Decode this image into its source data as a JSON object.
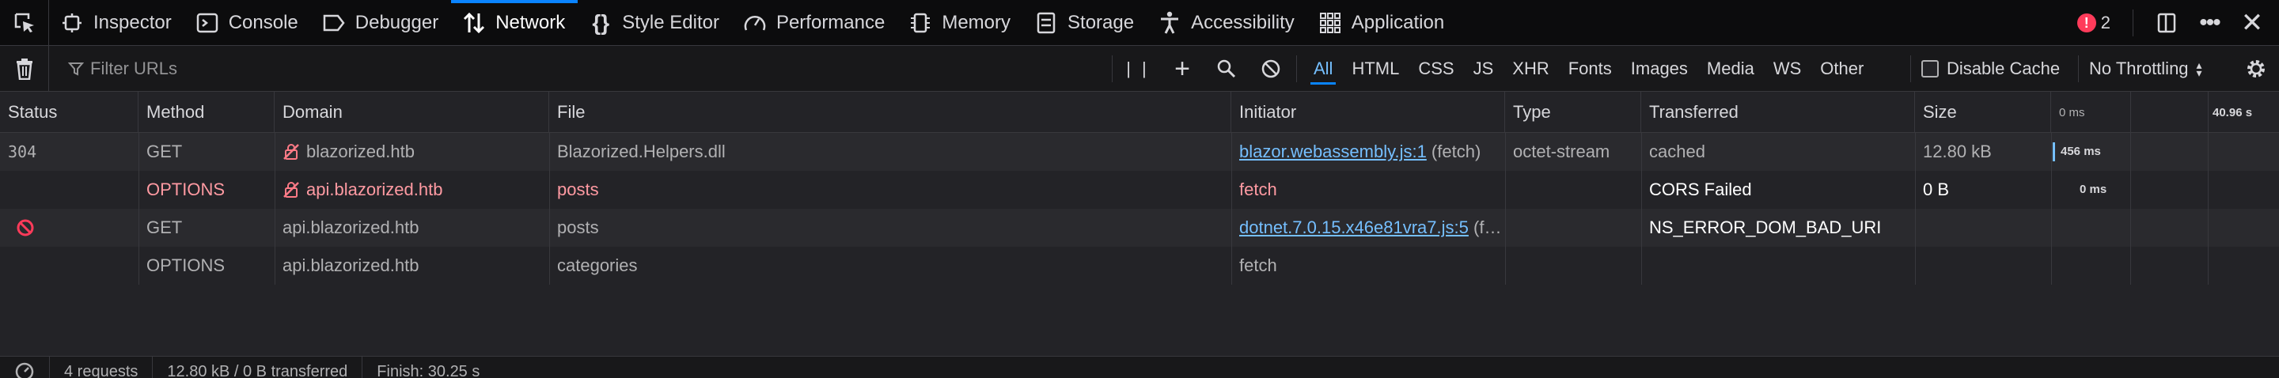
{
  "toolbox": {
    "tabs": [
      {
        "label": "Inspector",
        "icon": "inspector-icon"
      },
      {
        "label": "Console",
        "icon": "console-icon"
      },
      {
        "label": "Debugger",
        "icon": "debugger-icon"
      },
      {
        "label": "Network",
        "icon": "network-icon",
        "selected": true
      },
      {
        "label": "Style Editor",
        "icon": "style-editor-icon"
      },
      {
        "label": "Performance",
        "icon": "performance-icon"
      },
      {
        "label": "Memory",
        "icon": "memory-icon"
      },
      {
        "label": "Storage",
        "icon": "storage-icon"
      },
      {
        "label": "Accessibility",
        "icon": "accessibility-icon"
      },
      {
        "label": "Application",
        "icon": "application-icon"
      }
    ],
    "error_count": "2",
    "accent_color": "#0a84ff",
    "error_color": "#ff3b5a"
  },
  "toolbar": {
    "filter_placeholder": "Filter URLs",
    "type_filters": [
      "All",
      "HTML",
      "CSS",
      "JS",
      "XHR",
      "Fonts",
      "Images",
      "Media",
      "WS",
      "Other"
    ],
    "active_filter": "All",
    "disable_cache_label": "Disable Cache",
    "disable_cache_checked": false,
    "throttling": "No Throttling"
  },
  "table": {
    "columns": [
      "Status",
      "Method",
      "Domain",
      "File",
      "Initiator",
      "Type",
      "Transferred",
      "Size"
    ],
    "timeline_ticks": [
      "0 ms",
      "40.96 s"
    ],
    "rows": [
      {
        "status": "304",
        "method": "GET",
        "domain": "blazorized.htb",
        "domain_insecure": true,
        "file": "Blazorized.Helpers.dll",
        "initiator_link": "blazor.webassembly.js:1",
        "initiator_extra": " (fetch)",
        "type": "octet-stream",
        "transferred": "cached",
        "size": "12.80 kB",
        "timing": "456 ms",
        "style": "normal"
      },
      {
        "status": "",
        "method": "OPTIONS",
        "domain": "api.blazorized.htb",
        "domain_insecure": true,
        "file": "posts",
        "initiator_link": "",
        "initiator_extra": "fetch",
        "type": "",
        "transferred": "CORS Failed",
        "size": "0 B",
        "timing": "0 ms",
        "style": "error"
      },
      {
        "status": "blocked",
        "method": "GET",
        "domain": "api.blazorized.htb",
        "domain_insecure": false,
        "file": "posts",
        "initiator_link": "dotnet.7.0.15.x46e81vra7.js:5",
        "initiator_extra": " (f…",
        "type": "",
        "transferred": "NS_ERROR_DOM_BAD_URI",
        "size": "",
        "timing": "",
        "style": "blocked"
      },
      {
        "status": "",
        "method": "OPTIONS",
        "domain": "api.blazorized.htb",
        "domain_insecure": false,
        "file": "categories",
        "initiator_link": "",
        "initiator_extra": "fetch",
        "type": "",
        "transferred": "",
        "size": "",
        "timing": "",
        "style": "normal"
      }
    ]
  },
  "statusbar": {
    "requests": "4 requests",
    "transferred": "12.80 kB / 0 B transferred",
    "finish": "Finish: 30.25 s"
  }
}
